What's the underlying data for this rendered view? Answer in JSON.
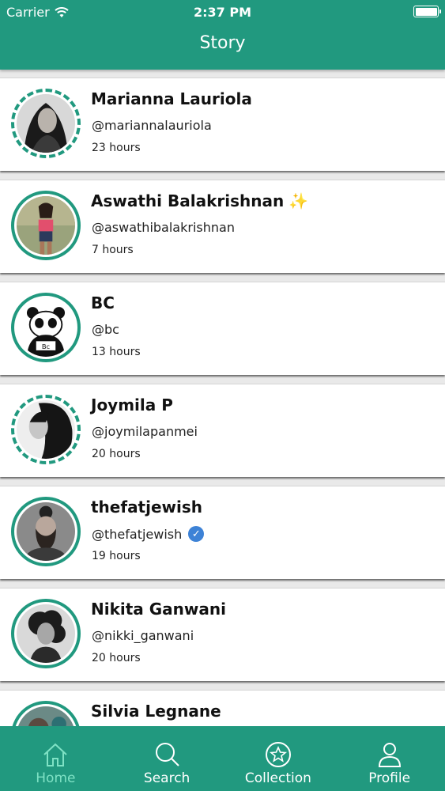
{
  "status_bar": {
    "carrier": "Carrier",
    "time": "2:37 PM"
  },
  "header": {
    "title": "Story"
  },
  "stories": [
    {
      "name": "Marianna Lauriola",
      "handle": "@mariannalauriola",
      "time": "23 hours",
      "avatar_icon": "portrait-woman-dark"
    },
    {
      "name": "Aswathi Balakrishnan",
      "name_emoji": "✨",
      "handle": "@aswathibalakrishnan",
      "time": "7 hours",
      "avatar_icon": "portrait-woman-pink-top"
    },
    {
      "name": "BC",
      "handle": "@bc",
      "time": "13 hours",
      "avatar_icon": "panda-logo"
    },
    {
      "name": "Joymila P",
      "handle": "@joymilapanmei",
      "time": "20 hours",
      "avatar_icon": "portrait-woman-bw"
    },
    {
      "name": "thefatjewish",
      "handle": "@thefatjewish",
      "verified": true,
      "time": "19 hours",
      "avatar_icon": "portrait-man-beard"
    },
    {
      "name": "Nikita Ganwani",
      "handle": "@nikki_ganwani",
      "time": "20 hours",
      "avatar_icon": "portrait-woman-curly"
    },
    {
      "name": "Silvia Legnane",
      "handle": "",
      "time": "",
      "avatar_icon": "portrait-partial"
    }
  ],
  "tabs": [
    {
      "label": "Home",
      "icon": "home-icon",
      "active": true
    },
    {
      "label": "Search",
      "icon": "search-icon",
      "active": false
    },
    {
      "label": "Collection",
      "icon": "star-circle-icon",
      "active": false
    },
    {
      "label": "Profile",
      "icon": "person-icon",
      "active": false
    }
  ],
  "colors": {
    "brand": "#21997f",
    "active_tab": "#7fe2c5",
    "verified": "#3d82d6"
  }
}
